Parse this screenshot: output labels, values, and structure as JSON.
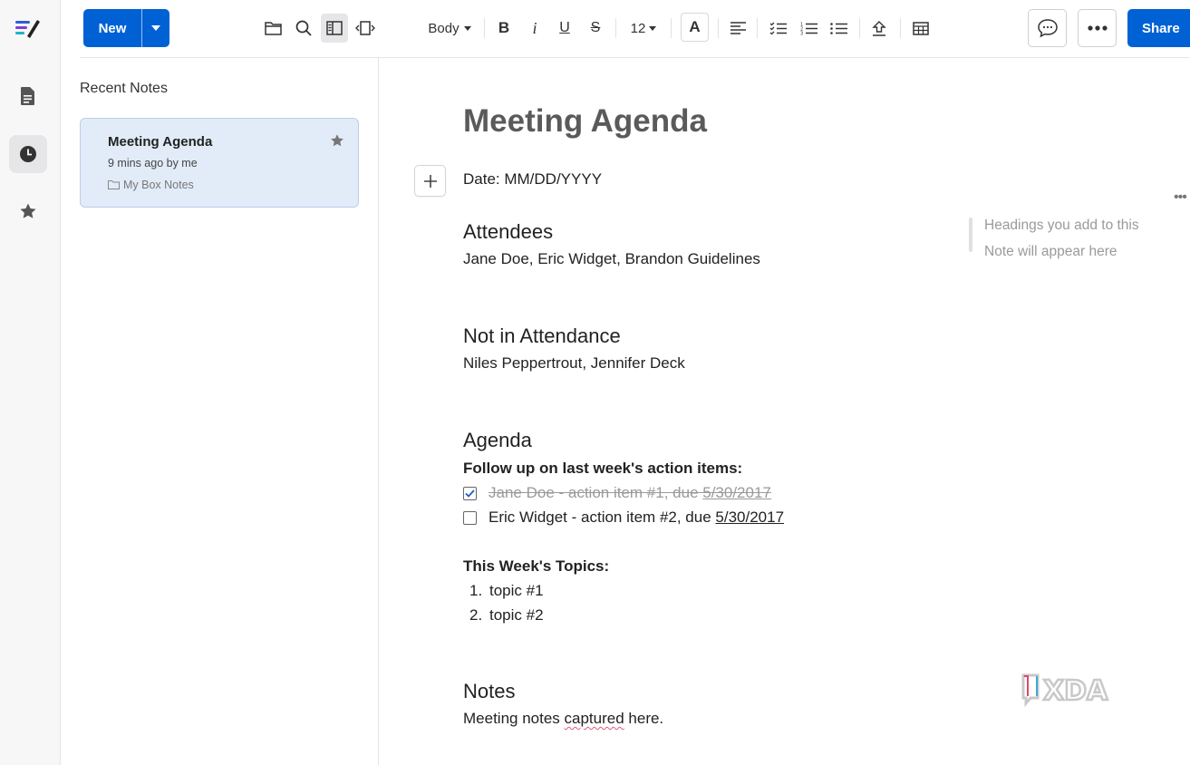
{
  "toolbar": {
    "new_label": "New",
    "text_style": "Body",
    "font_size": "12",
    "share_label": "Share"
  },
  "notes_panel": {
    "title": "Recent Notes",
    "notes": [
      {
        "title": "Meeting Agenda",
        "meta": "9 mins ago by me",
        "folder": "My Box Notes",
        "starred": true
      }
    ]
  },
  "document": {
    "title": "Meeting Agenda",
    "date_line": "Date: MM/DD/YYYY",
    "attendees_heading": "Attendees",
    "attendees": "Jane Doe, Eric Widget, Brandon Guidelines",
    "absent_heading": "Not in Attendance",
    "absent": "Niles Peppertrout, Jennifer Deck",
    "agenda_heading": "Agenda",
    "followup_label": "Follow up on last week's action items:",
    "action_items": [
      {
        "text": "Jane Doe - action item #1, due ",
        "date": "5/30/2017",
        "checked": true
      },
      {
        "text": "Eric Widget - action item #2, due ",
        "date": "5/30/2017",
        "checked": false
      }
    ],
    "topics_label": "This Week's Topics:",
    "topics": [
      {
        "num": "1.",
        "text": "topic #1"
      },
      {
        "num": "2.",
        "text": "topic #2"
      }
    ],
    "notes_heading": "Notes",
    "notes_text_before": "Meeting notes ",
    "notes_text_squiggle": "captured",
    "notes_text_after": " here."
  },
  "outline": {
    "placeholder": "Headings you add to this Note will appear here"
  },
  "watermark": {
    "text": "XDA"
  },
  "colors": {
    "accent": "#0061d5",
    "card_bg": "#e2ecf8",
    "muted": "#9a9a9a"
  }
}
